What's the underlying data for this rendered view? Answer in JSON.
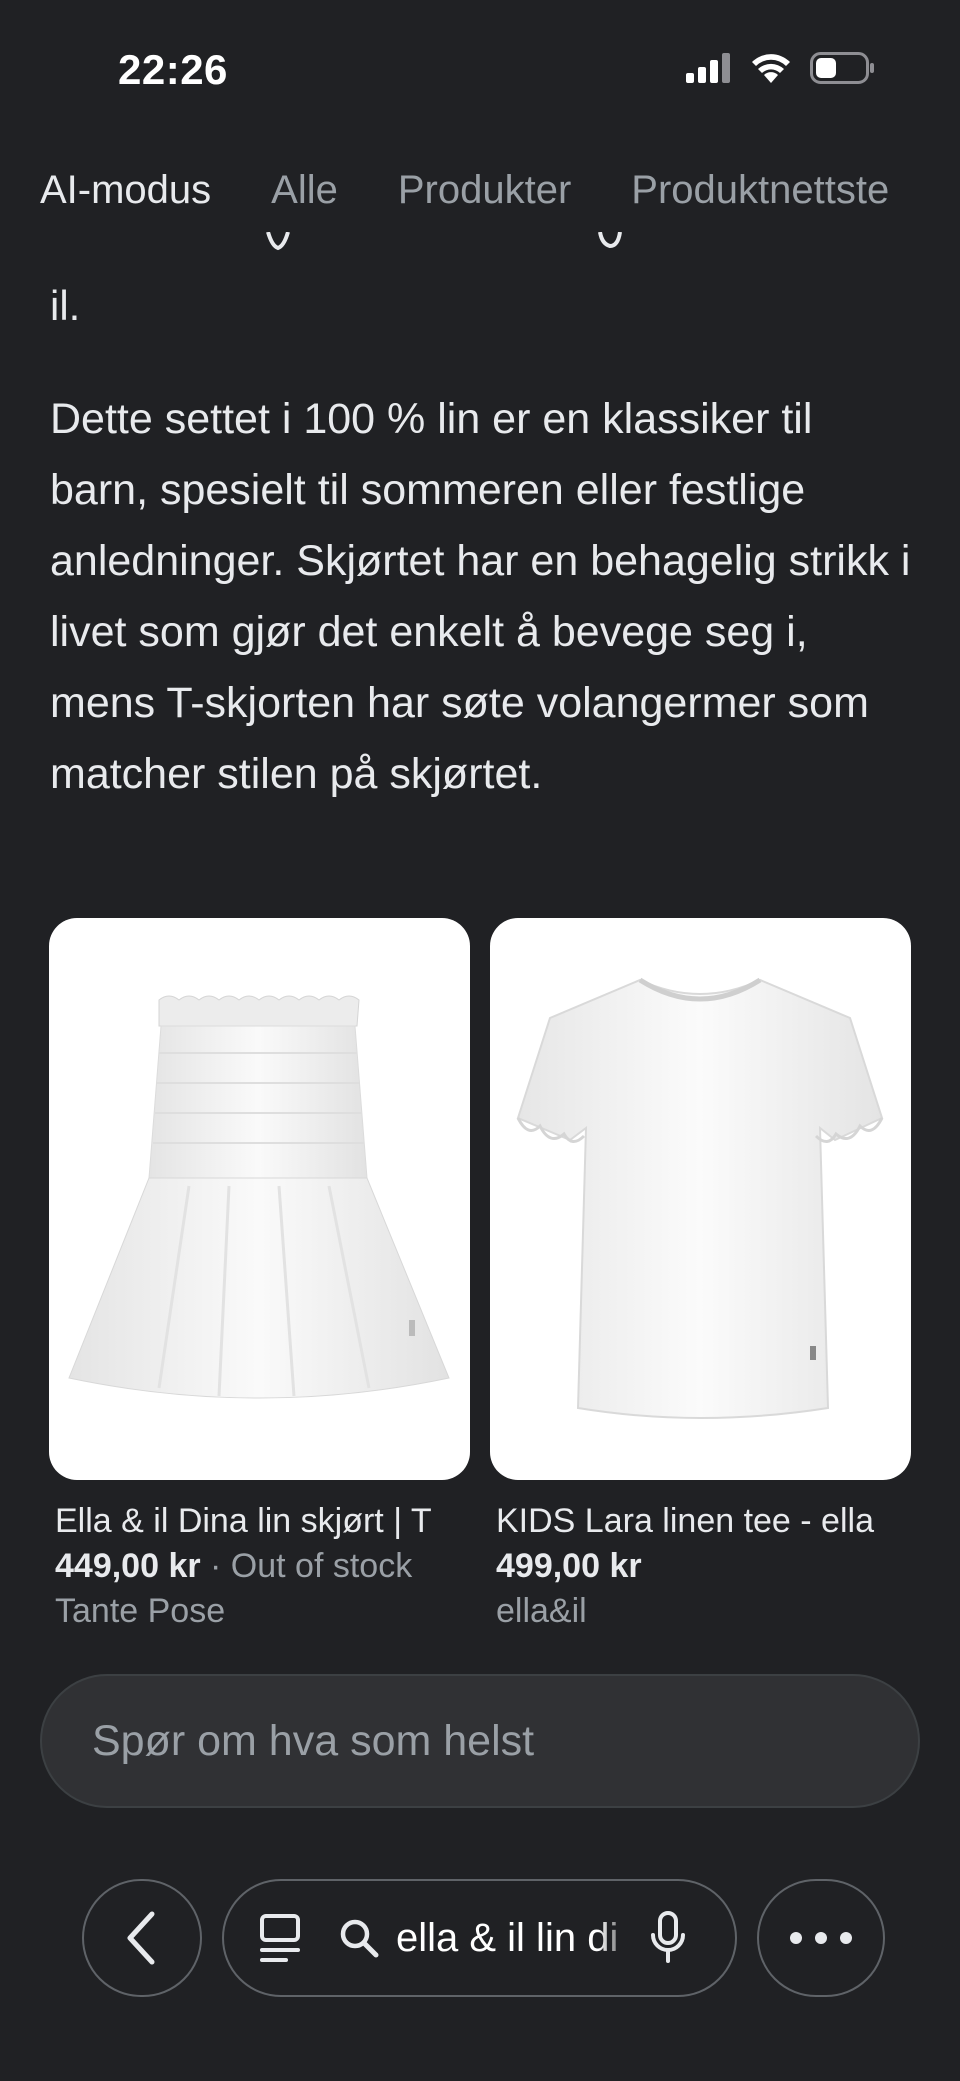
{
  "status_bar": {
    "time": "22:26",
    "icons": [
      "cellular-signal-icon",
      "wifi-icon",
      "battery-icon"
    ]
  },
  "tabs": [
    {
      "label": "AI-modus",
      "active": true
    },
    {
      "label": "Alle",
      "active": false
    },
    {
      "label": "Produkter",
      "active": false
    },
    {
      "label": "Produktnettste",
      "active": false
    }
  ],
  "content": {
    "partial_text": "il.",
    "paragraph": "Dette settet i 100 % lin er en klassiker til barn, spesielt til sommeren eller festlige anledninger. Skjørtet har en behagelig strikk i livet som gjør det enkelt å bevege seg i, mens T-skjorten har søte volangermer som matcher stilen på skjørtet."
  },
  "products": [
    {
      "title": "Ella & il Dina lin skjørt | T",
      "price": "449,00 kr",
      "stock": " · Out of stock",
      "source": "Tante Pose",
      "image_icon": "white-skirt-image"
    },
    {
      "title": "KIDS Lara linen tee - ella",
      "price": "499,00 kr",
      "stock": "",
      "source": "ella&il",
      "image_icon": "white-tshirt-image"
    }
  ],
  "ask": {
    "placeholder": "Spør om hva som helst"
  },
  "toolbar": {
    "search_text": "ella & il lin di",
    "icons": [
      "back-icon",
      "tabs-icon",
      "search-icon",
      "mic-icon",
      "more-icon"
    ]
  },
  "colors": {
    "background": "#202124",
    "text": "#e8eaed",
    "muted": "#9aa0a6",
    "input_bg": "#303134"
  }
}
